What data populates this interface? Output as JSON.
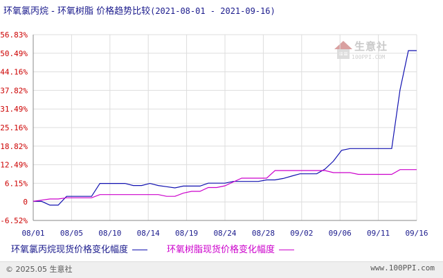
{
  "header": {
    "title": "环氧氯丙烷 - 环氧树脂 价格趋势比较",
    "date_range": "(2021-08-01 - 2021-09-16)"
  },
  "watermark": {
    "name": "生意社",
    "url": "100PPI.COM"
  },
  "legend": {
    "series1": "环氧氯丙烷现货价格变化幅度",
    "series2": "环氧树脂现货价格变化幅度"
  },
  "footer": {
    "copyright": "© 2025.05 生意社",
    "site": "www.100PPI.com"
  },
  "colors": {
    "series1": "#1010b0",
    "series2": "#cc00cc",
    "ytick": "#cc0000",
    "xtick": "#1a1a8c",
    "grid": "#dddddd",
    "axis": "#888888"
  },
  "chart_data": {
    "type": "line",
    "xlabel": "",
    "ylabel": "",
    "x_ticks": [
      "08/01",
      "08/05",
      "08/10",
      "08/14",
      "08/19",
      "08/24",
      "08/28",
      "09/02",
      "09/06",
      "09/11",
      "09/16"
    ],
    "y_ticks": [
      "56.83%",
      "50.49%",
      "44.16%",
      "37.82%",
      "31.49%",
      "25.16%",
      "18.82%",
      "12.49%",
      "6.15%",
      "0",
      "-6.52%"
    ],
    "ylim": [
      -6.52,
      56.83
    ],
    "grid": true,
    "legend_position": "bottom",
    "x": [
      "2021-08-01",
      "2021-08-02",
      "2021-08-03",
      "2021-08-04",
      "2021-08-05",
      "2021-08-06",
      "2021-08-07",
      "2021-08-08",
      "2021-08-09",
      "2021-08-10",
      "2021-08-11",
      "2021-08-12",
      "2021-08-13",
      "2021-08-14",
      "2021-08-15",
      "2021-08-16",
      "2021-08-17",
      "2021-08-18",
      "2021-08-19",
      "2021-08-20",
      "2021-08-21",
      "2021-08-22",
      "2021-08-23",
      "2021-08-24",
      "2021-08-25",
      "2021-08-26",
      "2021-08-27",
      "2021-08-28",
      "2021-08-29",
      "2021-08-30",
      "2021-08-31",
      "2021-09-01",
      "2021-09-02",
      "2021-09-03",
      "2021-09-04",
      "2021-09-05",
      "2021-09-06",
      "2021-09-07",
      "2021-09-08",
      "2021-09-09",
      "2021-09-10",
      "2021-09-11",
      "2021-09-12",
      "2021-09-13",
      "2021-09-14",
      "2021-09-15",
      "2021-09-16"
    ],
    "series": [
      {
        "name": "环氧氯丙烷现货价格变化幅度",
        "values": [
          0,
          0,
          -1.3,
          -1.3,
          1.7,
          1.7,
          1.7,
          1.7,
          6.1,
          6.1,
          6.1,
          6.1,
          5.4,
          5.4,
          6.1,
          5.4,
          5.0,
          4.6,
          5.2,
          5.2,
          5.2,
          6.2,
          6.2,
          6.2,
          6.8,
          6.8,
          6.8,
          6.8,
          7.3,
          7.3,
          7.8,
          8.6,
          9.4,
          9.4,
          9.4,
          11.0,
          13.7,
          17.4,
          18.0,
          18.0,
          18.0,
          18.0,
          18.0,
          18.0,
          38.0,
          51.4,
          51.4
        ]
      },
      {
        "name": "环氧树脂现货价格变化幅度",
        "values": [
          0,
          0.4,
          0.8,
          0.8,
          1.2,
          1.2,
          1.2,
          1.2,
          2.3,
          2.3,
          2.3,
          2.3,
          2.3,
          2.3,
          2.3,
          2.3,
          1.7,
          1.7,
          2.8,
          3.4,
          3.4,
          4.7,
          4.7,
          5.3,
          6.6,
          7.9,
          7.9,
          7.9,
          7.9,
          10.5,
          10.5,
          10.5,
          10.5,
          10.5,
          10.5,
          10.5,
          9.8,
          9.8,
          9.8,
          9.2,
          9.2,
          9.2,
          9.2,
          9.2,
          10.8,
          10.8,
          10.8
        ]
      }
    ]
  }
}
